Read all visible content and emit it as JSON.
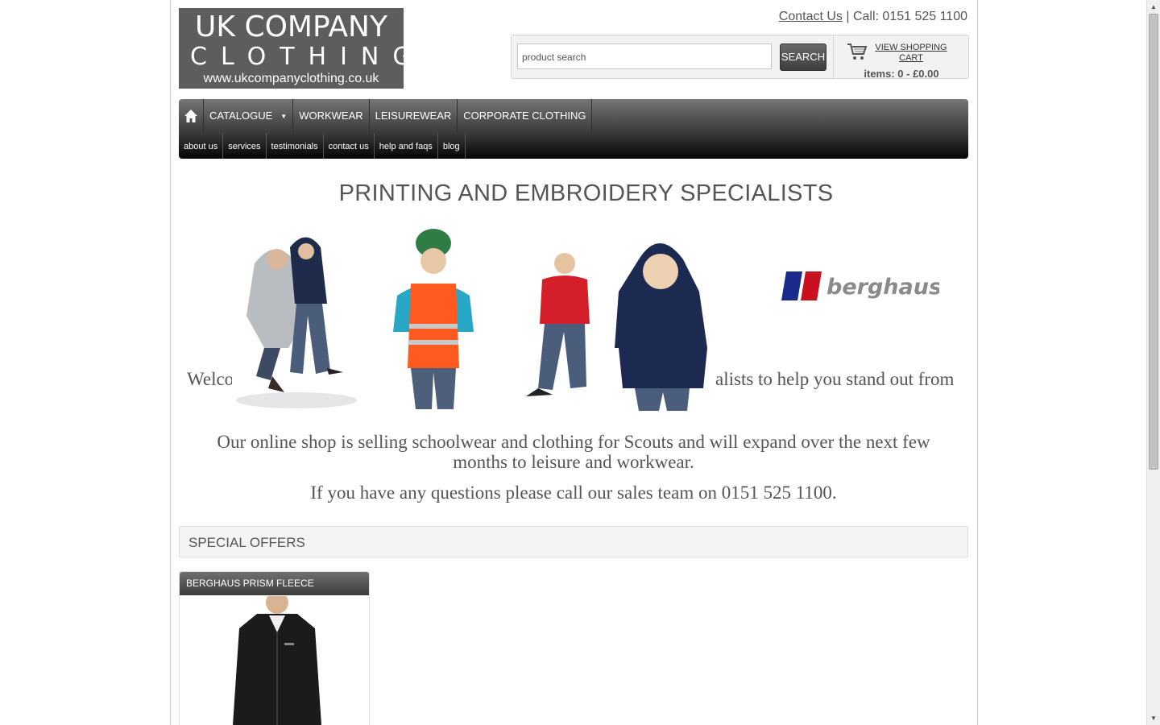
{
  "logo": {
    "line1": "UK COMPANY",
    "line2": "CLOTHING",
    "line3": "www.ukcompanyclothing.co.uk"
  },
  "header": {
    "contact_link": "Contact Us",
    "call_text": "| Call: 0151 525 1100"
  },
  "search": {
    "placeholder": "product search",
    "button_label": "SEARCH"
  },
  "cart": {
    "link_label": "VIEW SHOPPING CART",
    "items_text": "items: 0 - £0.00"
  },
  "nav_main": {
    "items": [
      {
        "label": "CATALOGUE",
        "dropdown": true
      },
      {
        "label": "WORKWEAR"
      },
      {
        "label": "LEISUREWEAR"
      },
      {
        "label": "CORPORATE CLOTHING"
      }
    ]
  },
  "nav_sub": {
    "items": [
      {
        "label": "about us"
      },
      {
        "label": "services"
      },
      {
        "label": "testimonials"
      },
      {
        "label": "contact us"
      },
      {
        "label": "help and faqs"
      },
      {
        "label": "blog"
      }
    ]
  },
  "main": {
    "headline": "PRINTING AND EMBROIDERY SPECIALISTS",
    "welcome_left": "Welco",
    "welcome_right": "alists to help you stand out from",
    "paragraph1": "Our online shop is selling schoolwear and clothing for Scouts and will expand over the next few months to leisure and workwear.",
    "paragraph2": "If you have any questions please call our sales team on 0151 525 1100.",
    "berghaus_logo": "berghaus"
  },
  "special_offers": {
    "heading": "SPECIAL OFFERS",
    "products": [
      {
        "title": "BERGHAUS PRISM FLEECE"
      }
    ]
  },
  "colors": {
    "logo_bg": "#5f5c5c",
    "nav_bg": "#4a4a4a",
    "text_gray": "#555555"
  }
}
